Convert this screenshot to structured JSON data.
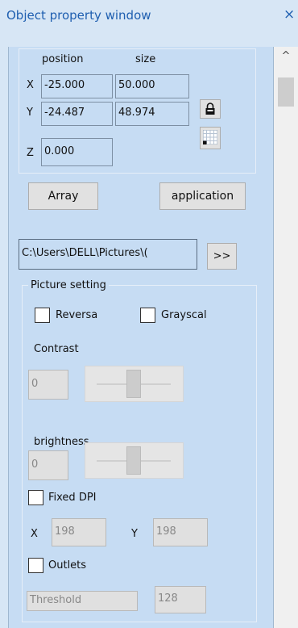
{
  "window": {
    "title": "Object property window",
    "close_glyph": "×"
  },
  "scroll": {
    "up_glyph": "^"
  },
  "transform": {
    "position_header": "position",
    "size_header": "size",
    "x_label": "X",
    "y_label": "Y",
    "z_label": "Z",
    "x_pos": "-25.000",
    "y_pos": "-24.487",
    "z_pos": "0.000",
    "x_size": "50.000",
    "y_size": "48.974"
  },
  "buttons": {
    "array": "Array",
    "application": "application",
    "browse": ">>"
  },
  "file_path": "C:\\Users\\DELL\\Pictures\\(",
  "picture": {
    "legend": "Picture setting",
    "reverse": "Reversa",
    "grayscale": "Grayscal",
    "contrast_label": "Contrast",
    "contrast_value": "0",
    "brightness_label": "brightness",
    "brightness_value": "0",
    "fixed_dpi": "Fixed DPI",
    "dpi_x_label": "X",
    "dpi_x": "198",
    "dpi_y_label": "Y",
    "dpi_y": "198",
    "outlets": "Outlets",
    "threshold_label": "Threshold",
    "threshold_value": "128"
  }
}
